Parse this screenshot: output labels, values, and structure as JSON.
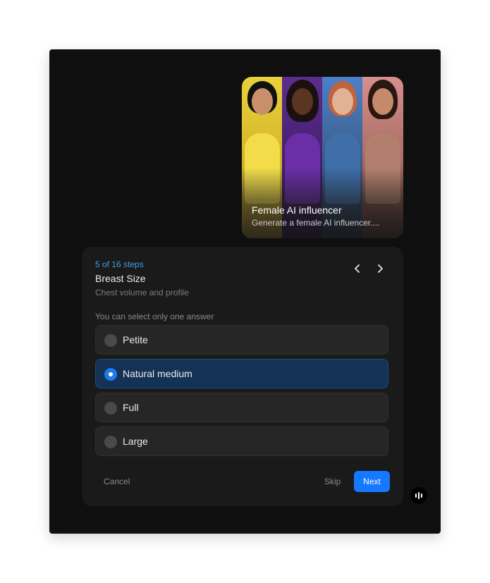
{
  "card": {
    "title": "Female AI influencer",
    "subtitle": "Generate a female AI influencer...."
  },
  "wizard": {
    "steps_text": "5 of 16 steps",
    "question_title": "Breast Size",
    "question_desc": "Chest volume and profile",
    "hint": "You can select only one answer",
    "options": [
      {
        "label": "Petite",
        "selected": false
      },
      {
        "label": "Natural medium",
        "selected": true
      },
      {
        "label": "Full",
        "selected": false
      },
      {
        "label": "Large",
        "selected": false
      }
    ],
    "cancel_label": "Cancel",
    "skip_label": "Skip",
    "next_label": "Next"
  },
  "icons": {
    "prev": "chevron-left-icon",
    "next": "chevron-right-icon",
    "fab": "audio-bars-icon"
  },
  "colors": {
    "accent": "#1677ff",
    "selected_bg": "#143256",
    "steps_text": "#3aa0e8"
  }
}
